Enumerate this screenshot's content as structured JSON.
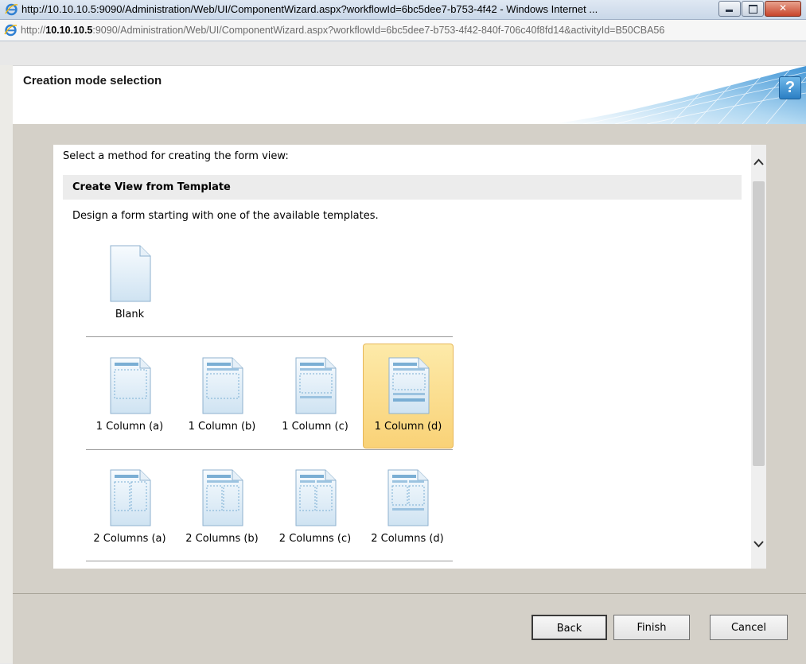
{
  "window": {
    "title": "http://10.10.10.5:9090/Administration/Web/UI/ComponentWizard.aspx?workflowId=6bc5dee7-b753-4f42 - Windows Internet ...",
    "address_prefix": "http://",
    "address_host": "10.10.10.5",
    "address_rest": ":9090/Administration/Web/UI/ComponentWizard.aspx?workflowId=6bc5dee7-b753-4f42-840f-706c40f8fd14&activityId=B50CBA56"
  },
  "header": {
    "title": "Creation mode selection",
    "help_label": "?"
  },
  "content": {
    "intro": "Select a method for creating the form view:",
    "section_title": "Create View from Template",
    "section_desc": "Design a form starting with one of the available templates.",
    "templates": [
      {
        "label": "Blank",
        "selected": false
      },
      {
        "label": "1 Column (a)",
        "selected": false
      },
      {
        "label": "1 Column (b)",
        "selected": false
      },
      {
        "label": "1 Column (c)",
        "selected": false
      },
      {
        "label": "1 Column (d)",
        "selected": true
      },
      {
        "label": "2 Columns (a)",
        "selected": false
      },
      {
        "label": "2 Columns (b)",
        "selected": false
      },
      {
        "label": "2 Columns (c)",
        "selected": false
      },
      {
        "label": "2 Columns (d)",
        "selected": false
      }
    ]
  },
  "scrollbar": {
    "up_icon": "chevron-up-icon",
    "down_icon": "chevron-down-icon"
  },
  "footer": {
    "back_label": "Back",
    "finish_label": "Finish",
    "cancel_label": "Cancel"
  },
  "colors": {
    "selected_tile": "#f9d277",
    "panel_bg": "#d4d0c8",
    "help_blue": "#2b7fc4"
  }
}
